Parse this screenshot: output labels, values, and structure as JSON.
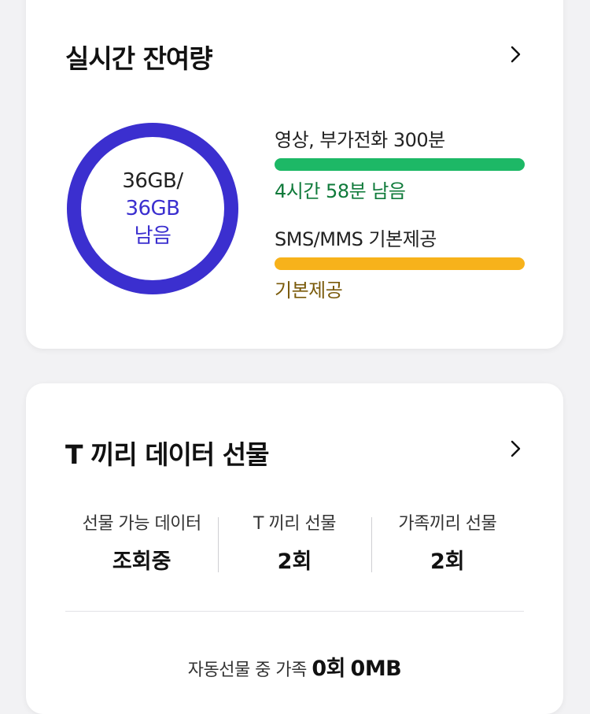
{
  "realtime": {
    "title": "실시간 잔여량",
    "data": {
      "used_label": "36GB/",
      "total_label": "36GB",
      "remain_label": "남음",
      "remaining_fraction": 1.0,
      "ring_color": "#3b2fcf"
    },
    "voice": {
      "label": "영상, 부가전화 300분",
      "status": "4시간 58분 남음",
      "bar_color": "#1db866",
      "status_color": "#0f7a3a",
      "remaining_fraction": 1.0
    },
    "sms": {
      "label": "SMS/MMS 기본제공",
      "status": "기본제공",
      "bar_color": "#f7b21b",
      "status_color": "#7a5a0a",
      "remaining_fraction": 1.0
    }
  },
  "gift": {
    "title": "T 끼리 데이터 선물",
    "stats": [
      {
        "label": "선물 가능 데이터",
        "value": "조회중"
      },
      {
        "label": "T 끼리 선물",
        "value": "2회"
      },
      {
        "label": "가족끼리 선물",
        "value": "2회"
      }
    ],
    "auto_gift": {
      "prefix": "자동선물 중 가족 ",
      "count": "0회",
      "amount": "0MB"
    }
  },
  "icons": {
    "chevron": "chevron-right-icon"
  }
}
